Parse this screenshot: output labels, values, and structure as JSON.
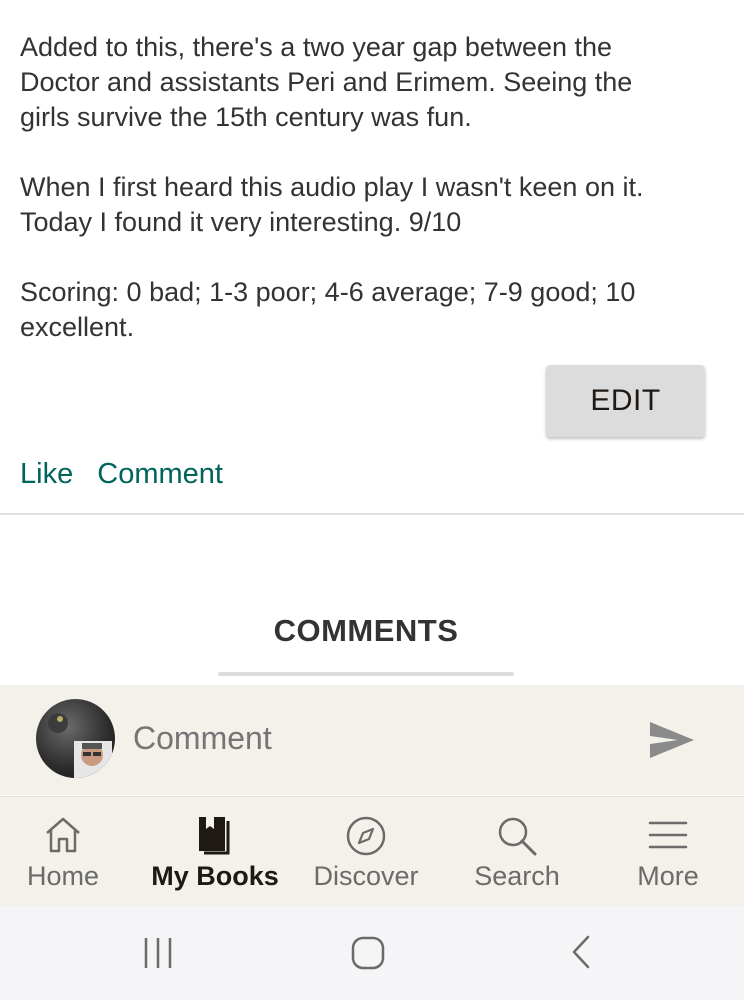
{
  "review": {
    "paragraphs": [
      "Added to this, there's a two year gap between the\nDoctor and assistants Peri and Erimem. Seeing the\ngirls survive the 15th century was fun.",
      "When I first heard this audio play I wasn't keen on it.\nToday I found it very interesting. 9/10",
      "Scoring: 0 bad; 1-3 poor; 4-6 average; 7-9 good; 10\nexcellent."
    ],
    "edit_label": "EDIT"
  },
  "actions": {
    "like_label": "Like",
    "comment_label": "Comment"
  },
  "comments": {
    "heading": "COMMENTS",
    "input_placeholder": "Comment"
  },
  "bottom_nav": {
    "items": [
      {
        "label": "Home",
        "icon": "home-icon"
      },
      {
        "label": "My Books",
        "icon": "my-books-icon",
        "active": true
      },
      {
        "label": "Discover",
        "icon": "compass-icon"
      },
      {
        "label": "Search",
        "icon": "search-icon"
      },
      {
        "label": "More",
        "icon": "menu-icon"
      }
    ]
  },
  "colors": {
    "link": "#00635d",
    "bar_bg": "#f3f1ea",
    "button_bg": "#dcdcdc"
  }
}
